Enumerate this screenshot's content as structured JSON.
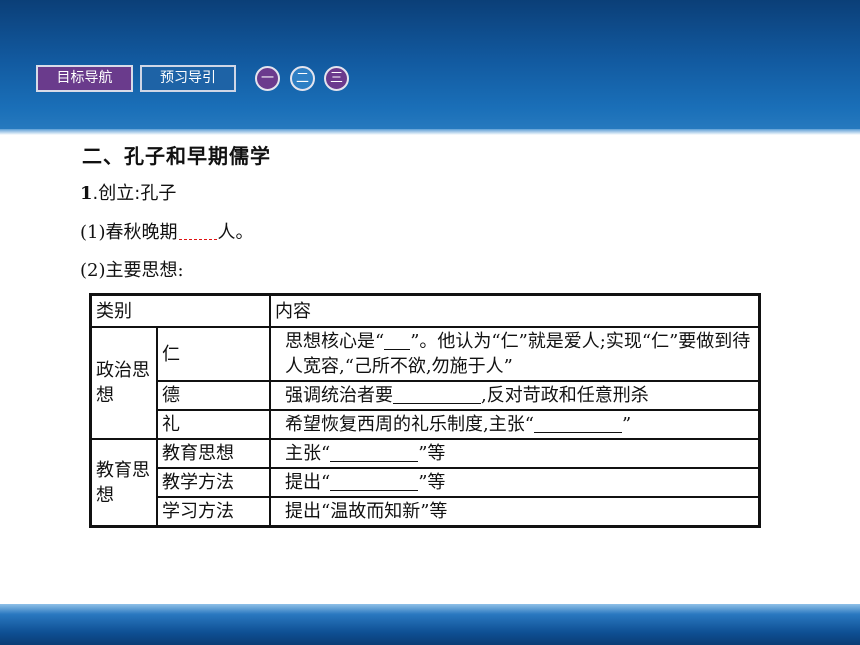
{
  "nav": {
    "goal_label": "目标导航",
    "preview_label": "预习导引",
    "sections": [
      "一",
      "二",
      "三"
    ]
  },
  "content": {
    "heading": "二、孔子和早期儒学",
    "item1_num": "1",
    "item1_text": ".创立:孔子",
    "item1_1_before": "(1)春秋晚期",
    "item1_1_after": "人。",
    "item1_2": "(2)主要思想:"
  },
  "table": {
    "header": [
      "类别",
      "内容"
    ],
    "politics_label": "政治思想",
    "edu_label": "教育思想",
    "ren": {
      "name": "仁",
      "text_a": "思想核心是“",
      "text_b": "”。他认为“仁”就是爱人;实现“仁”要做到待人宽容,“己所不欲,勿施于人”"
    },
    "de": {
      "name": "德",
      "text_a": "强调统治者要",
      "text_b": ",反对苛政和任意刑杀"
    },
    "li": {
      "name": "礼",
      "text_a": "希望恢复西周的礼乐制度,主张“",
      "text_b": "”"
    },
    "edu_thought": {
      "name": "教育思想",
      "text_a": "主张“",
      "text_b": "”等"
    },
    "teach_method": {
      "name": "教学方法",
      "text_a": "提出“",
      "text_b": "”等"
    },
    "study_method": {
      "name": "学习方法",
      "text": "提出“温故而知新”等"
    }
  }
}
